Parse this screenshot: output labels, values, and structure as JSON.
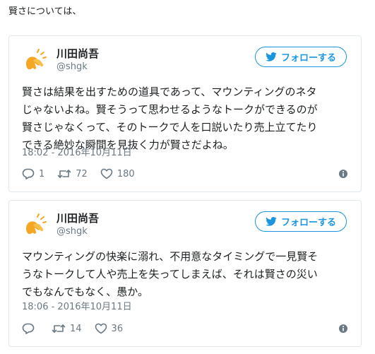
{
  "intro_text": "賢さについては、",
  "colors": {
    "accent": "#1b95e0",
    "muted": "#697882",
    "text": "#1c2022",
    "border": "#e1e8ed"
  },
  "tweets": [
    {
      "author": {
        "name": "川田尚吾",
        "handle": "@shgk",
        "avatar_icon": "hand-clap-icon"
      },
      "follow_label": "フォローする",
      "text": "賢さは結果を出すための道具であって、マウンティングのネタ\nじゃないよね。賢そうって思わせるようなトークができるのが\n賢さじゃなくって、そのトークで人を口説いたり売上立てたり\nできる絶妙な瞬間を見抜く力が賢さだよね。",
      "timestamp": "18:02 - 2016年10月11日",
      "replies": "1",
      "retweets": "72",
      "likes": "180"
    },
    {
      "author": {
        "name": "川田尚吾",
        "handle": "@shgk",
        "avatar_icon": "hand-clap-icon"
      },
      "follow_label": "フォローする",
      "text": "マウンティングの快楽に溺れ、不用意なタイミングで一見賢そ\nうなトークして人や売上を失ってしまえば、それは賢さの災い\nでもなんでもなく、愚か。",
      "timestamp": "18:06 - 2016年10月11日",
      "replies": "",
      "retweets": "14",
      "likes": "36"
    }
  ]
}
